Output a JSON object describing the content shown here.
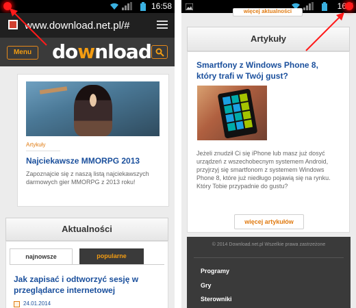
{
  "colors": {
    "accent": "#f39c12",
    "link_blue": "#1a4f9c",
    "status_bar": "#000000",
    "header_bg": "#3a3a3a",
    "marker_red": "#ff1a1a"
  },
  "status": {
    "time_left": "16:58",
    "time_right": "16:5"
  },
  "browser": {
    "url": "www.download.net.pl/#"
  },
  "header": {
    "menu_label": "Menu",
    "logo_pre": "do",
    "logo_mid": "w",
    "logo_post": "nload"
  },
  "left_article": {
    "category": "Artykuły",
    "title": "Najciekawsze MMORPG 2013",
    "excerpt": "Zapoznajcie się z naszą listą najciekawszych darmowych gier MMORPG z 2013 roku!"
  },
  "news": {
    "heading": "Aktualności",
    "tab_new": "najnowsze",
    "tab_popular": "popularne",
    "item_title": "Jak zapisać i odtworzyć sesję w przeglądarce internetowej",
    "item_date": "24.01.2014"
  },
  "right_page": {
    "top_button": "więcej aktualności",
    "heading": "Artykuły",
    "article_title": "Smartfony z Windows Phone 8, który trafi w Twój gust?",
    "article_text": "Jeżeli znudził Ci się iPhone lub masz już dosyć urządzeń z wszechobecnym systemem Android, przyjrzyj się smartfonom z systemem Windows Phone 8, które już niedługo pojawią się na rynku. Który Tobie przypadnie do gustu?",
    "more_button": "więcej artykułów",
    "copyright": "© 2014 Download.net.pl Wszelkie prawa zastrzeżone",
    "footer_links": [
      "Programy",
      "Gry",
      "Sterowniki"
    ]
  },
  "icons": [
    "browser-tab-icon",
    "hamburger-menu-icon",
    "search-icon",
    "calendar-icon",
    "wifi-icon",
    "signal-icon",
    "battery-icon",
    "red-arrow-icon"
  ]
}
